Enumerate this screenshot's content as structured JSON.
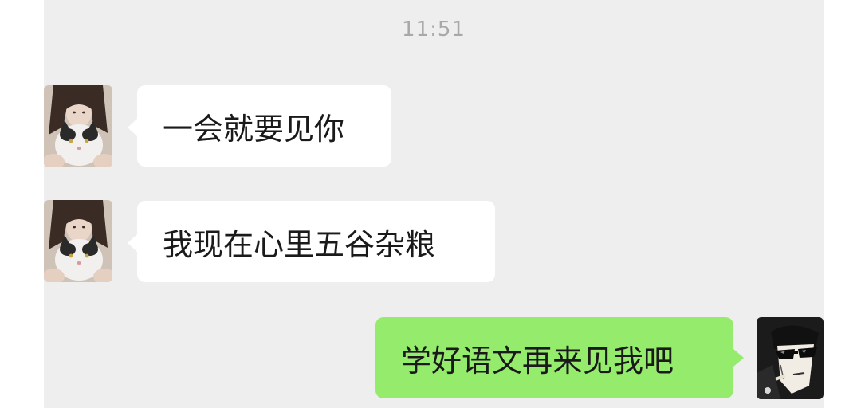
{
  "chat": {
    "timestamp": "11:51",
    "messages": [
      {
        "direction": "incoming",
        "sender": "contact",
        "avatar_icon": "girl-with-cat-avatar",
        "text": "一会就要见你"
      },
      {
        "direction": "incoming",
        "sender": "contact",
        "avatar_icon": "girl-with-cat-avatar",
        "text": "我现在心里五谷杂粮"
      },
      {
        "direction": "outgoing",
        "sender": "me",
        "avatar_icon": "anime-man-sunglasses-avatar",
        "text": "学好语文再来见我吧"
      }
    ]
  },
  "colors": {
    "chat_background": "#eeeeef",
    "incoming_bubble": "#ffffff",
    "outgoing_bubble": "#95eb6c",
    "timestamp_text": "#a8a8aa"
  }
}
